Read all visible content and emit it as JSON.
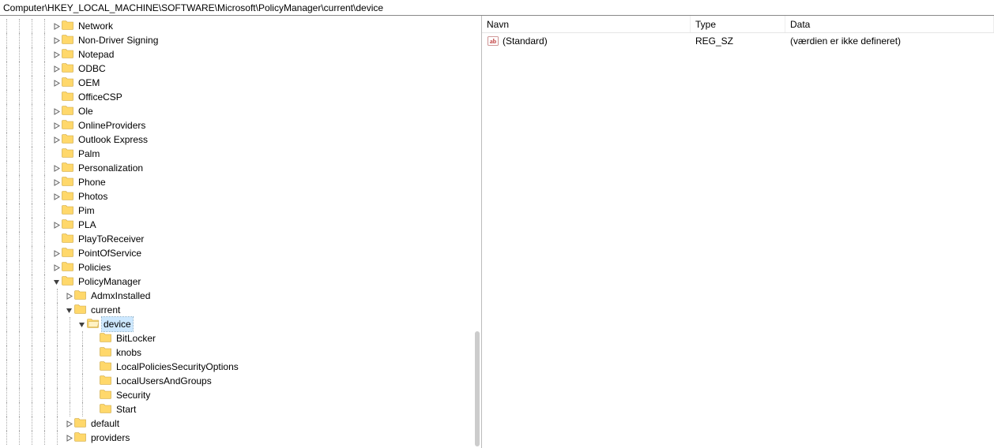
{
  "address_bar": "Computer\\HKEY_LOCAL_MACHINE\\SOFTWARE\\Microsoft\\PolicyManager\\current\\device",
  "columns": {
    "name": "Navn",
    "type": "Type",
    "data": "Data"
  },
  "tree": [
    {
      "indent": 4,
      "expander": "closed",
      "label": "Network",
      "selected": false
    },
    {
      "indent": 4,
      "expander": "closed",
      "label": "Non-Driver Signing",
      "selected": false
    },
    {
      "indent": 4,
      "expander": "closed",
      "label": "Notepad",
      "selected": false
    },
    {
      "indent": 4,
      "expander": "closed",
      "label": "ODBC",
      "selected": false
    },
    {
      "indent": 4,
      "expander": "closed",
      "label": "OEM",
      "selected": false
    },
    {
      "indent": 4,
      "expander": "none",
      "label": "OfficeCSP",
      "selected": false
    },
    {
      "indent": 4,
      "expander": "closed",
      "label": "Ole",
      "selected": false
    },
    {
      "indent": 4,
      "expander": "closed",
      "label": "OnlineProviders",
      "selected": false
    },
    {
      "indent": 4,
      "expander": "closed",
      "label": "Outlook Express",
      "selected": false
    },
    {
      "indent": 4,
      "expander": "none",
      "label": "Palm",
      "selected": false
    },
    {
      "indent": 4,
      "expander": "closed",
      "label": "Personalization",
      "selected": false
    },
    {
      "indent": 4,
      "expander": "closed",
      "label": "Phone",
      "selected": false
    },
    {
      "indent": 4,
      "expander": "closed",
      "label": "Photos",
      "selected": false
    },
    {
      "indent": 4,
      "expander": "none",
      "label": "Pim",
      "selected": false
    },
    {
      "indent": 4,
      "expander": "closed",
      "label": "PLA",
      "selected": false
    },
    {
      "indent": 4,
      "expander": "none",
      "label": "PlayToReceiver",
      "selected": false
    },
    {
      "indent": 4,
      "expander": "closed",
      "label": "PointOfService",
      "selected": false
    },
    {
      "indent": 4,
      "expander": "closed",
      "label": "Policies",
      "selected": false
    },
    {
      "indent": 4,
      "expander": "open",
      "label": "PolicyManager",
      "selected": false
    },
    {
      "indent": 5,
      "expander": "closed",
      "label": "AdmxInstalled",
      "selected": false
    },
    {
      "indent": 5,
      "expander": "open",
      "label": "current",
      "selected": false
    },
    {
      "indent": 6,
      "expander": "open",
      "label": "device",
      "selected": true,
      "open": true
    },
    {
      "indent": 7,
      "expander": "none",
      "label": "BitLocker",
      "selected": false
    },
    {
      "indent": 7,
      "expander": "none",
      "label": "knobs",
      "selected": false
    },
    {
      "indent": 7,
      "expander": "none",
      "label": "LocalPoliciesSecurityOptions",
      "selected": false
    },
    {
      "indent": 7,
      "expander": "none",
      "label": "LocalUsersAndGroups",
      "selected": false
    },
    {
      "indent": 7,
      "expander": "none",
      "label": "Security",
      "selected": false
    },
    {
      "indent": 7,
      "expander": "none",
      "label": "Start",
      "selected": false
    },
    {
      "indent": 5,
      "expander": "closed",
      "label": "default",
      "selected": false
    },
    {
      "indent": 5,
      "expander": "closed",
      "label": "providers",
      "selected": false
    }
  ],
  "values": [
    {
      "name": "(Standard)",
      "type": "REG_SZ",
      "data": "(værdien er ikke defineret)",
      "icon": "string"
    }
  ]
}
